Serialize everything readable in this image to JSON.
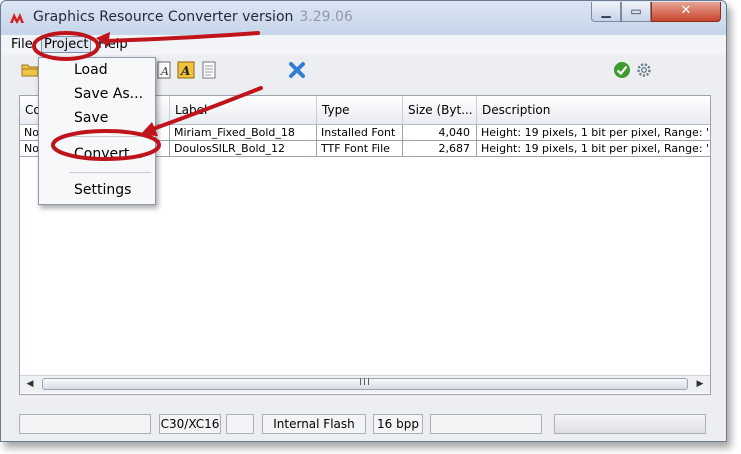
{
  "window": {
    "title": "Graphics Resource Converter version",
    "version": "3.29.06",
    "minimize_glyph": "▁",
    "maximize_glyph": "▭",
    "close_glyph": "✕"
  },
  "menubar": {
    "file": "File",
    "project": "Project",
    "help": "Help"
  },
  "project_menu": {
    "items": [
      "Load",
      "Save As...",
      "Save",
      "Convert...",
      "Settings"
    ]
  },
  "toolbar": {
    "icons": [
      "open-folder-icon",
      "add-font-icon",
      "font-icon",
      "document-icon",
      "remove-icon",
      "check-icon",
      "gear-icon"
    ]
  },
  "table": {
    "headers": [
      "Co",
      "Label",
      "Type",
      "Size (Byt...",
      "Description"
    ],
    "rows": [
      {
        "compress": "No",
        "label": "Miriam_Fixed_Bold_18",
        "type": "Installed Font",
        "size": "4,040",
        "description": "Height: 19 pixels, 1 bit per pixel, Range: '"
      },
      {
        "compress": "No",
        "label": "DoulosSILR_Bold_12",
        "type": "TTF Font File",
        "size": "2,687",
        "description": "Height: 19 pixels, 1 bit per pixel, Range: '"
      }
    ],
    "scroll_left": "◀",
    "scroll_right": "▶",
    "scroll_grip": "III"
  },
  "statusbar": {
    "cells": [
      "",
      "C30/XC16",
      "",
      "Internal Flash",
      "16 bpp",
      ""
    ]
  },
  "colors": {
    "annotation_red": "#c0141c",
    "check_green": "#3c9a2e",
    "remove_blue": "#2f7fd6"
  }
}
